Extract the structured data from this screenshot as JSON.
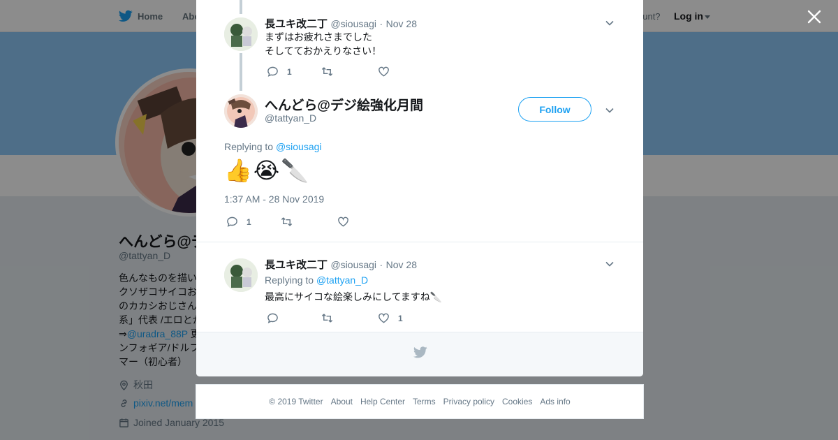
{
  "nav": {
    "home_label": "Home",
    "about_label": "Abo",
    "account_prompt": "ccount?",
    "login_label": "Log in"
  },
  "profile": {
    "name": "へんどら@デ",
    "handle": "@tattyan_D",
    "bio_lines": [
      {
        "text": "色んなものを描い"
      },
      {
        "text": "クソザコサイコお"
      },
      {
        "text": "のカカシおじさん"
      },
      {
        "text": "系」代表 /エロとか"
      },
      {
        "prefix": "⇒",
        "mention": "@uradra_88P",
        "suffix": " 更"
      },
      {
        "text": "ンフォギア/ドルフ"
      },
      {
        "text": "マー（初心者）"
      }
    ],
    "location": "秋田",
    "website": "pixiv.net/mem",
    "joined": "Joined January 2015"
  },
  "tweets": [
    {
      "name": "長ユキ改二丁",
      "handle": "@siousagi",
      "date": "Nov 28",
      "lines": [
        "まずはお疲れさまでした",
        "そしてておかえりなさい！"
      ],
      "replies": "1",
      "retweets": "",
      "likes": ""
    }
  ],
  "main_tweet": {
    "name": "へんどら@デジ絵強化月間",
    "handle": "@tattyan_D",
    "follow_label": "Follow",
    "replying_label": "Replying to",
    "replying_mention": "@siousagi",
    "emoji": "👍😭🔪",
    "timestamp": "1:37 AM - 28 Nov 2019",
    "replies": "1",
    "retweets": "",
    "likes": ""
  },
  "reply_tweet": {
    "name": "長ユキ改二丁",
    "handle": "@siousagi",
    "date": "Nov 28",
    "replying_label": "Replying to",
    "replying_mention": "@tattyan_D",
    "text": "最高にサイコな絵楽しみにしてますね🔪",
    "replies": "",
    "retweets": "",
    "likes": "1"
  },
  "footer": {
    "links": [
      "© 2019 Twitter",
      "About",
      "Help Center",
      "Terms",
      "Privacy policy",
      "Cookies",
      "Ads info"
    ]
  },
  "colors": {
    "accent": "#1da1f2",
    "banner": "#8ec9f7",
    "secondary_text": "#657786"
  },
  "icons": [
    "twitter-bird-icon",
    "close-icon",
    "chevron-down-icon",
    "reply-icon",
    "retweet-icon",
    "like-icon",
    "location-icon",
    "link-icon",
    "calendar-icon"
  ]
}
